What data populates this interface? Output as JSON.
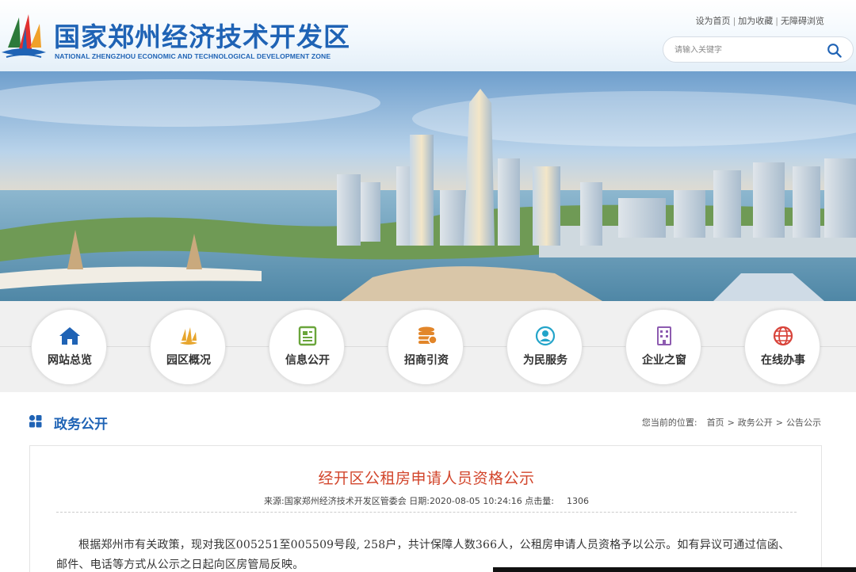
{
  "header": {
    "title": "国家郑州经济技术开发区",
    "subtitle": "NATIONAL ZHENGZHOU ECONOMIC AND TECHNOLOGICAL DEVELOPMENT ZONE",
    "top_links": [
      "设为首页",
      "加为收藏",
      "无障碍浏览"
    ],
    "search": {
      "placeholder": "请输入关键字",
      "icon": "search-icon"
    },
    "brand_color": "#1f63b5"
  },
  "nav": {
    "items": [
      {
        "label": "网站总览",
        "icon": "home-icon",
        "color": "#1f63b5"
      },
      {
        "label": "园区概况",
        "icon": "sail-logo-icon",
        "color": "#e7a52c"
      },
      {
        "label": "信息公开",
        "icon": "document-icon",
        "color": "#6aa53b"
      },
      {
        "label": "招商引资",
        "icon": "coins-icon",
        "color": "#e2862a"
      },
      {
        "label": "为民服务",
        "icon": "person-service-icon",
        "color": "#23a4c9"
      },
      {
        "label": "企业之窗",
        "icon": "building-icon",
        "color": "#8d5bb0"
      },
      {
        "label": "在线办事",
        "icon": "globe-icon",
        "color": "#d8433a"
      }
    ]
  },
  "section": {
    "title": "政务公开",
    "icon": "grid-icon",
    "breadcrumb_prefix": "您当前的位置:",
    "breadcrumb": [
      "首页",
      "政务公开",
      "公告公示"
    ]
  },
  "article": {
    "title": "经开区公租房申请人员资格公示",
    "source_label": "来源:",
    "source": "国家郑州经济技术开发区管委会",
    "date_label": "日期:",
    "date": "2020-08-05 10:24:16",
    "views_label": "点击量:",
    "views": "1306",
    "body": "根据郑州市有关政策，现对我区005251至005509号段, 258户，共计保障人数366人，公租房申请人员资格予以公示。如有异议可通过信函、邮件、电话等方式从公示之日起向区房管局反映。",
    "title_color": "#d2452b"
  }
}
